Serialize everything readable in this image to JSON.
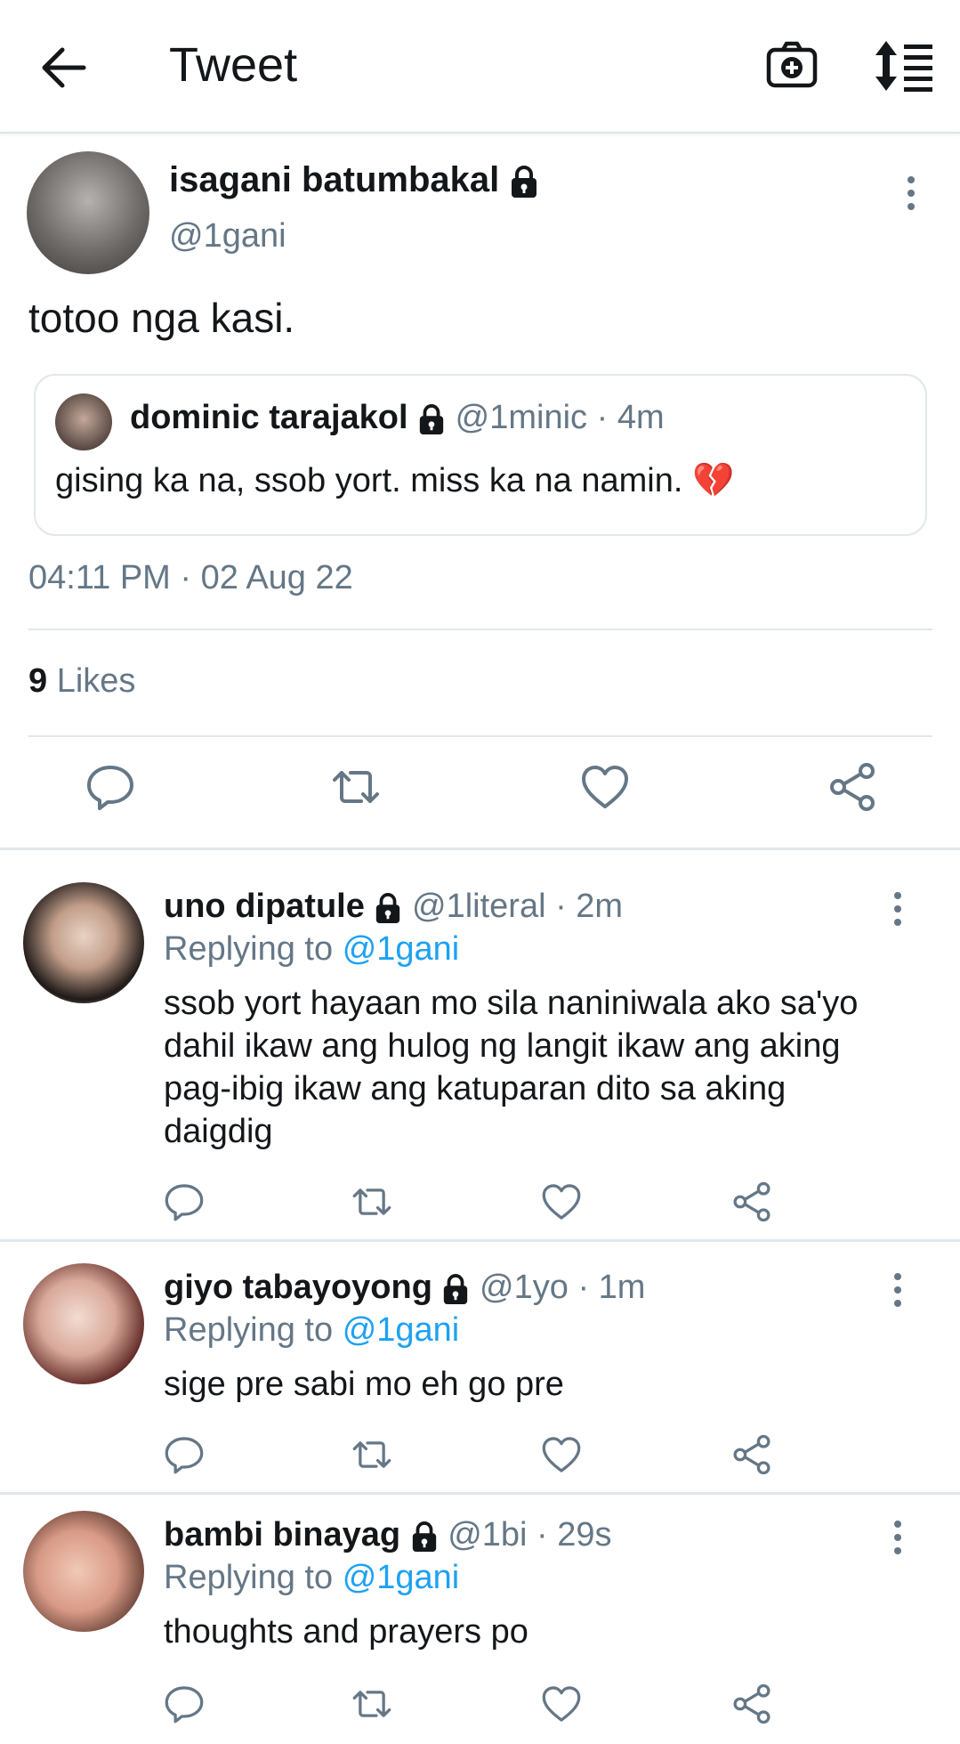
{
  "header": {
    "title": "Tweet",
    "back_icon": "arrow-left-icon",
    "camera_icon": "camera-plus-icon",
    "sort_icon": "sort-list-icon"
  },
  "tweet": {
    "name": "isagani batumbakal",
    "handle": "@1gani",
    "text": "totoo nga kasi.",
    "quote": {
      "name": "dominic tarajakol",
      "handle": "@1minic",
      "time": "· 4m",
      "text": "gising ka na, ssob yort. miss ka na namin. 💔"
    },
    "timestamp": "04:11 PM · 02 Aug 22",
    "likes_count": "9",
    "likes_label": "Likes"
  },
  "replies": [
    {
      "name": "uno dipatule",
      "handle": "@1literal",
      "time": "· 2m",
      "replying_prefix": "Replying to",
      "replying_to": "@1gani",
      "lines": [
        "ssob yort hayaan mo sila naniniwala ako sa'yo",
        "dahil ikaw ang hulog ng langit ikaw ang aking",
        "pag-ibig ikaw ang katuparan dito sa aking",
        "daigdig"
      ]
    },
    {
      "name": "giyo tabayoyong",
      "handle": "@1yo",
      "time": "· 1m",
      "replying_prefix": "Replying to",
      "replying_to": "@1gani",
      "lines": [
        "sige pre sabi mo eh go pre"
      ]
    },
    {
      "name": "bambi binayag",
      "handle": "@1bi",
      "time": "· 29s",
      "replying_prefix": "Replying to",
      "replying_to": "@1gani",
      "lines": [
        "thoughts and prayers po"
      ]
    }
  ],
  "colors": {
    "link": "#1da1f2",
    "muted": "#657786",
    "text": "#14171a",
    "heart_broken": "#e0245e"
  }
}
